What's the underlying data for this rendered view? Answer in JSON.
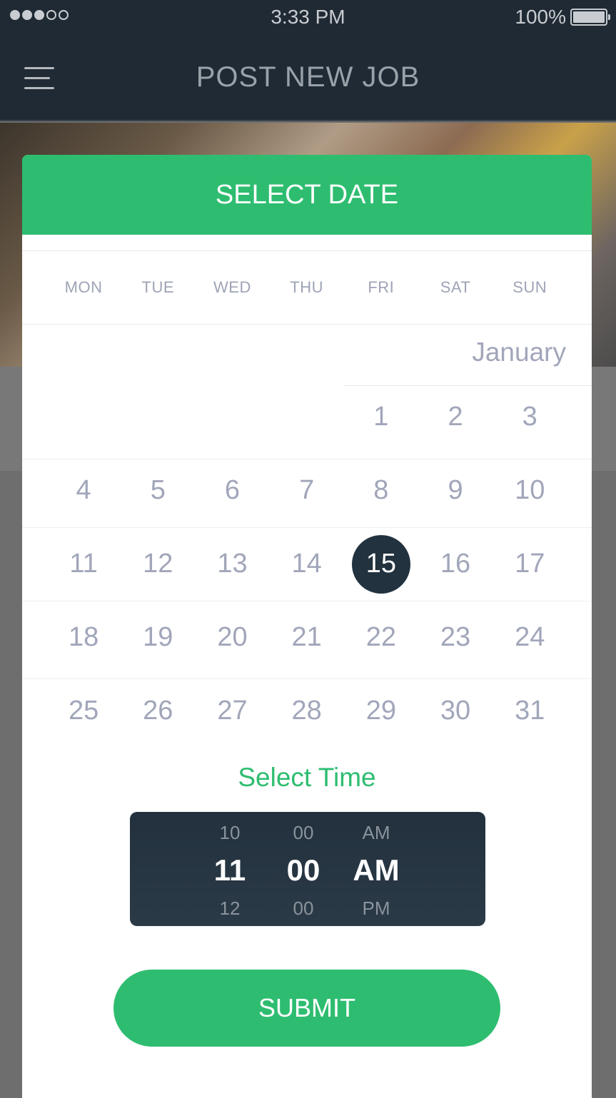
{
  "status_bar": {
    "time": "3:33 PM",
    "battery": "100%",
    "battery_level": 1.0
  },
  "nav": {
    "title": "POST NEW JOB",
    "menu_icon": "hamburger-menu-icon"
  },
  "date_picker": {
    "title": "SELECT DATE",
    "weekdays": [
      "MON",
      "TUE",
      "WED",
      "THU",
      "FRI",
      "SAT",
      "SUN"
    ],
    "month": "January",
    "weeks": [
      [
        "",
        "",
        "",
        "",
        "1",
        "2",
        "3"
      ],
      [
        "4",
        "5",
        "6",
        "7",
        "8",
        "9",
        "10"
      ],
      [
        "11",
        "12",
        "13",
        "14",
        "15",
        "16",
        "17"
      ],
      [
        "18",
        "19",
        "20",
        "21",
        "22",
        "23",
        "24"
      ],
      [
        "25",
        "26",
        "27",
        "28",
        "29",
        "30",
        "31"
      ]
    ],
    "selected_day": "15"
  },
  "time_picker": {
    "label": "Select Time",
    "hour": {
      "prev": "10",
      "current": "11",
      "next": "12"
    },
    "minute": {
      "prev": "00",
      "current": "00",
      "next": "00"
    },
    "period": {
      "prev": "AM",
      "current": "AM",
      "next": "PM"
    }
  },
  "submit_label": "SUBMIT",
  "colors": {
    "accent": "#2ebd70",
    "dark": "#1f2a34",
    "selected_circle": "#22323f",
    "day_text": "#a1a6ba"
  }
}
